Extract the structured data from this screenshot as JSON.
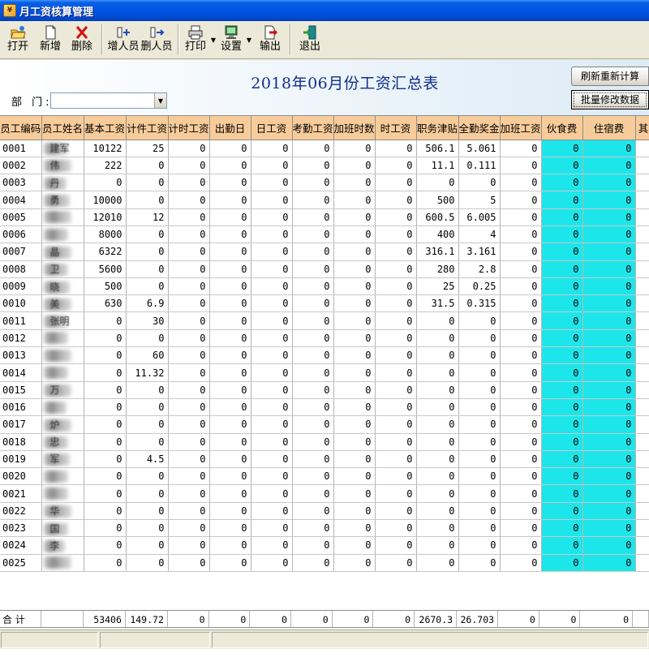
{
  "window": {
    "title": "月工资核算管理"
  },
  "toolbar": {
    "items": [
      {
        "id": "open",
        "label": "打开",
        "icon": "folder-open-icon"
      },
      {
        "id": "new",
        "label": "新增",
        "icon": "new-document-icon"
      },
      {
        "id": "delete",
        "label": "删除",
        "icon": "red-x-icon"
      },
      {
        "id": "add-staff",
        "label": "增人员",
        "icon": "add-user-icon"
      },
      {
        "id": "remove-staff",
        "label": "删人员",
        "icon": "remove-user-icon"
      },
      {
        "id": "print",
        "label": "打印",
        "icon": "printer-icon"
      },
      {
        "id": "settings",
        "label": "设置",
        "icon": "monitor-settings-icon"
      },
      {
        "id": "export",
        "label": "输出",
        "icon": "export-icon"
      },
      {
        "id": "exit",
        "label": "退出",
        "icon": "exit-door-icon"
      }
    ]
  },
  "report": {
    "title": "2018年06月份工资汇总表",
    "dept_label": "部 门:",
    "dept_value": "",
    "recalc_button": "刷新重新计算",
    "batch_button": "批量修改数据"
  },
  "table": {
    "columns": [
      "员工编码",
      "员工姓名",
      "基本工资",
      "计件工资",
      "计时工资",
      "出勤日",
      "日工资",
      "考勤工资",
      "加班时数",
      "时工资",
      "职务津贴",
      "全勤奖金",
      "加班工资",
      "伙食费",
      "住宿费",
      "其"
    ],
    "rows": [
      {
        "code": "0001",
        "name_frag": "建军",
        "v": [
          "10122",
          "25",
          "0",
          "0",
          "0",
          "0",
          "0",
          "0",
          "506.1",
          "5.061",
          "0",
          "0",
          "0"
        ]
      },
      {
        "code": "0002",
        "name_frag": "伟",
        "v": [
          "222",
          "0",
          "0",
          "0",
          "0",
          "0",
          "0",
          "0",
          "11.1",
          "0.111",
          "0",
          "0",
          "0"
        ]
      },
      {
        "code": "0003",
        "name_frag": "丹",
        "v": [
          "0",
          "0",
          "0",
          "0",
          "0",
          "0",
          "0",
          "0",
          "0",
          "0",
          "0",
          "0",
          "0"
        ]
      },
      {
        "code": "0004",
        "name_frag": "勇",
        "v": [
          "10000",
          "0",
          "0",
          "0",
          "0",
          "0",
          "0",
          "0",
          "500",
          "5",
          "0",
          "0",
          "0"
        ]
      },
      {
        "code": "0005",
        "name_frag": "",
        "v": [
          "12010",
          "12",
          "0",
          "0",
          "0",
          "0",
          "0",
          "0",
          "600.5",
          "6.005",
          "0",
          "0",
          "0"
        ]
      },
      {
        "code": "0006",
        "name_frag": "",
        "v": [
          "8000",
          "0",
          "0",
          "0",
          "0",
          "0",
          "0",
          "0",
          "400",
          "4",
          "0",
          "0",
          "0"
        ]
      },
      {
        "code": "0007",
        "name_frag": "晶",
        "v": [
          "6322",
          "0",
          "0",
          "0",
          "0",
          "0",
          "0",
          "0",
          "316.1",
          "3.161",
          "0",
          "0",
          "0"
        ]
      },
      {
        "code": "0008",
        "name_frag": "卫",
        "v": [
          "5600",
          "0",
          "0",
          "0",
          "0",
          "0",
          "0",
          "0",
          "280",
          "2.8",
          "0",
          "0",
          "0"
        ]
      },
      {
        "code": "0009",
        "name_frag": "晓",
        "v": [
          "500",
          "0",
          "0",
          "0",
          "0",
          "0",
          "0",
          "0",
          "25",
          "0.25",
          "0",
          "0",
          "0"
        ]
      },
      {
        "code": "0010",
        "name_frag": "美",
        "v": [
          "630",
          "6.9",
          "0",
          "0",
          "0",
          "0",
          "0",
          "0",
          "31.5",
          "0.315",
          "0",
          "0",
          "0"
        ]
      },
      {
        "code": "0011",
        "name_frag": "张明",
        "v": [
          "0",
          "30",
          "0",
          "0",
          "0",
          "0",
          "0",
          "0",
          "0",
          "0",
          "0",
          "0",
          "0"
        ]
      },
      {
        "code": "0012",
        "name_frag": "",
        "v": [
          "0",
          "0",
          "0",
          "0",
          "0",
          "0",
          "0",
          "0",
          "0",
          "0",
          "0",
          "0",
          "0"
        ]
      },
      {
        "code": "0013",
        "name_frag": "",
        "v": [
          "0",
          "60",
          "0",
          "0",
          "0",
          "0",
          "0",
          "0",
          "0",
          "0",
          "0",
          "0",
          "0"
        ]
      },
      {
        "code": "0014",
        "name_frag": "",
        "v": [
          "0",
          "11.32",
          "0",
          "0",
          "0",
          "0",
          "0",
          "0",
          "0",
          "0",
          "0",
          "0",
          "0"
        ]
      },
      {
        "code": "0015",
        "name_frag": "万",
        "v": [
          "0",
          "0",
          "0",
          "0",
          "0",
          "0",
          "0",
          "0",
          "0",
          "0",
          "0",
          "0",
          "0"
        ]
      },
      {
        "code": "0016",
        "name_frag": "",
        "v": [
          "0",
          "0",
          "0",
          "0",
          "0",
          "0",
          "0",
          "0",
          "0",
          "0",
          "0",
          "0",
          "0"
        ]
      },
      {
        "code": "0017",
        "name_frag": "炉",
        "v": [
          "0",
          "0",
          "0",
          "0",
          "0",
          "0",
          "0",
          "0",
          "0",
          "0",
          "0",
          "0",
          "0"
        ]
      },
      {
        "code": "0018",
        "name_frag": "忠",
        "v": [
          "0",
          "0",
          "0",
          "0",
          "0",
          "0",
          "0",
          "0",
          "0",
          "0",
          "0",
          "0",
          "0"
        ]
      },
      {
        "code": "0019",
        "name_frag": "军",
        "v": [
          "0",
          "4.5",
          "0",
          "0",
          "0",
          "0",
          "0",
          "0",
          "0",
          "0",
          "0",
          "0",
          "0"
        ]
      },
      {
        "code": "0020",
        "name_frag": "",
        "v": [
          "0",
          "0",
          "0",
          "0",
          "0",
          "0",
          "0",
          "0",
          "0",
          "0",
          "0",
          "0",
          "0"
        ]
      },
      {
        "code": "0021",
        "name_frag": "",
        "v": [
          "0",
          "0",
          "0",
          "0",
          "0",
          "0",
          "0",
          "0",
          "0",
          "0",
          "0",
          "0",
          "0"
        ]
      },
      {
        "code": "0022",
        "name_frag": "华",
        "v": [
          "0",
          "0",
          "0",
          "0",
          "0",
          "0",
          "0",
          "0",
          "0",
          "0",
          "0",
          "0",
          "0"
        ]
      },
      {
        "code": "0023",
        "name_frag": "国",
        "v": [
          "0",
          "0",
          "0",
          "0",
          "0",
          "0",
          "0",
          "0",
          "0",
          "0",
          "0",
          "0",
          "0"
        ]
      },
      {
        "code": "0024",
        "name_frag": "李",
        "v": [
          "0",
          "0",
          "0",
          "0",
          "0",
          "0",
          "0",
          "0",
          "0",
          "0",
          "0",
          "0",
          "0"
        ]
      },
      {
        "code": "0025",
        "name_frag": "",
        "v": [
          "0",
          "0",
          "0",
          "0",
          "0",
          "0",
          "0",
          "0",
          "0",
          "0",
          "0",
          "0",
          "0"
        ]
      }
    ],
    "totals": {
      "label": "合 计",
      "v": [
        "53406",
        "149.72",
        "0",
        "0",
        "0",
        "0",
        "0",
        "0",
        "2670.3",
        "26.703",
        "0",
        "0",
        "0"
      ]
    }
  },
  "colors": {
    "header": "#f8cc9a",
    "highlight": "#1de6ea",
    "title": "#0f2f8c"
  }
}
